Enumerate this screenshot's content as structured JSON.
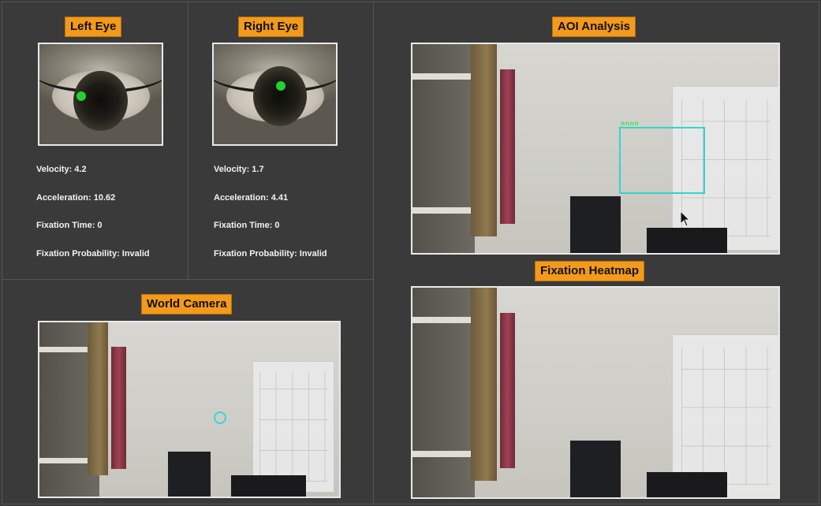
{
  "left_eye": {
    "title": "Left Eye",
    "velocity": "Velocity: 4.2",
    "acceleration": "Acceleration: 10.62",
    "fixation_time": "Fixation Time: 0",
    "fixation_probability": "Fixation Probability: Invalid"
  },
  "right_eye": {
    "title": "Right Eye",
    "velocity": "Velocity: 1.7",
    "acceleration": "Acceleration: 4.41",
    "fixation_time": "Fixation Time: 0",
    "fixation_probability": "Fixation Probability: Invalid"
  },
  "world_camera": {
    "title": "World Camera"
  },
  "aoi_analysis": {
    "title": "AOI Analysis",
    "aoi_label": "nnnn"
  },
  "fixation_heatmap": {
    "title": "Fixation Heatmap"
  },
  "colors": {
    "title_bg": "#f39a1c",
    "background": "#3a3a3a",
    "pupil_marker": "#22d22f",
    "aoi_box": "#2fd6d0",
    "gaze_ring": "#34d7dc"
  },
  "icons": [
    "pupil-marker-icon",
    "gaze-ring-icon",
    "mouse-cursor-icon"
  ]
}
